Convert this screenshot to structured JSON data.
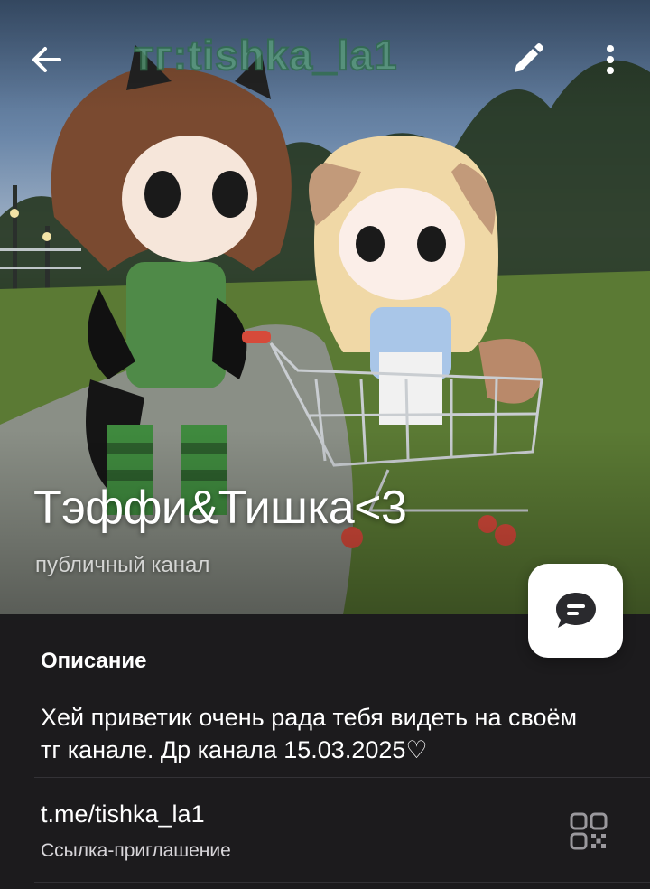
{
  "header": {
    "back_icon": "arrow-left-icon",
    "edit_icon": "pencil-icon",
    "menu_icon": "more-vertical-icon",
    "watermark_text": "тг:tishka_la1"
  },
  "channel": {
    "title": "Тэффи&Тишка<3",
    "subtitle": "публичный канал"
  },
  "chat_button": {
    "icon": "chat-bubble-icon"
  },
  "description": {
    "heading": "Описание",
    "text": "Хей приветик очень рада тебя видеть на своём тг канале. Др канала 15.03.2025♡"
  },
  "link": {
    "url": "t.me/tishka_la1",
    "caption": "Ссылка-приглашение",
    "qr_icon": "qr-code-icon"
  },
  "colors": {
    "background": "#1c1b1d",
    "text": "#ffffff",
    "divider": "#333236"
  }
}
